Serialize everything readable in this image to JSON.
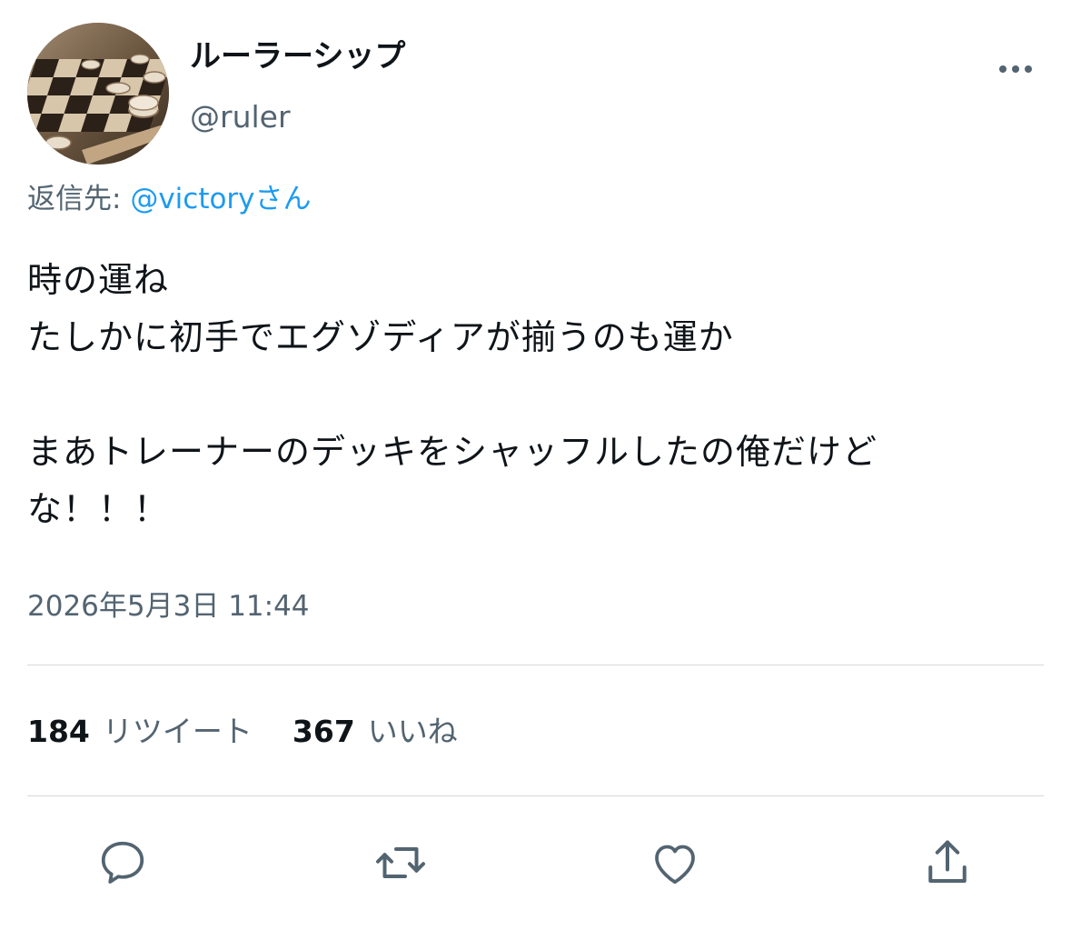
{
  "author": {
    "display_name": "ルーラーシップ",
    "handle": "@ruler",
    "avatar": "checkers-board-photo"
  },
  "menu": {
    "icon": "more-horizontal-icon"
  },
  "reply": {
    "prefix": "返信先: ",
    "mention": "@victory",
    "suffix": "さん"
  },
  "tweet": {
    "text": "時の運ね\nたしかに初手でエグゾディアが揃うのも運か\n\nまあトレーナーのデッキをシャッフルしたの俺だけど\nな！！！",
    "timestamp": "2026年5月3日 11:44"
  },
  "stats": {
    "retweets": {
      "count": "184",
      "label": "リツイート"
    },
    "likes": {
      "count": "367",
      "label": "いいね"
    }
  },
  "actions": [
    {
      "name": "reply",
      "icon": "reply-icon"
    },
    {
      "name": "retweet",
      "icon": "retweet-icon"
    },
    {
      "name": "like",
      "icon": "heart-icon"
    },
    {
      "name": "share",
      "icon": "share-icon"
    }
  ],
  "colors": {
    "text": "#0f1419",
    "secondary": "#536471",
    "link": "#1d9bf0",
    "divider": "#d4d7da"
  }
}
